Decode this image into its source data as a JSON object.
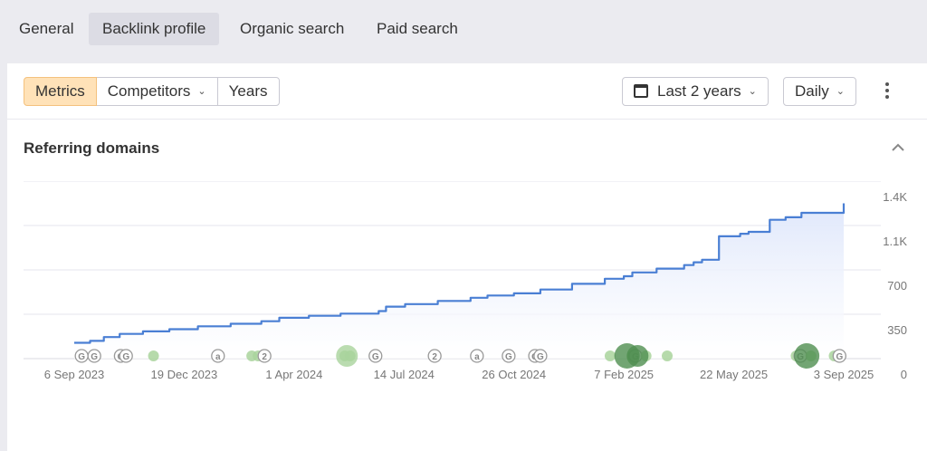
{
  "tabs": [
    "General",
    "Backlink profile",
    "Organic search",
    "Paid search"
  ],
  "active_tab": "Backlink profile",
  "toolbar": {
    "modes": [
      "Metrics",
      "Competitors",
      "Years"
    ],
    "active_mode": "Metrics",
    "date_range": "Last 2 years",
    "granularity": "Daily"
  },
  "card": {
    "title": "Referring domains"
  },
  "colors": {
    "line": "#4a7fd4",
    "area": "#dfe7fb",
    "event_light": "#a9d39c",
    "event_dark": "#4f8f50",
    "active_bg": "#ffe2b8"
  },
  "chart_data": {
    "type": "area",
    "title": "Referring domains",
    "x_tick_labels": [
      "6 Sep 2023",
      "19 Dec 2023",
      "1 Apr 2024",
      "14 Jul 2024",
      "26 Oct 2024",
      "7 Feb 2025",
      "22 May 2025",
      "3 Sep 2025"
    ],
    "y_tick_labels": [
      "1.4K",
      "1.1K",
      "700",
      "350",
      "0"
    ],
    "ylim": [
      0,
      1400
    ],
    "x_range": [
      "2023-09-06",
      "2025-09-03"
    ],
    "grid": true,
    "series": [
      {
        "x": [
          "2023-09-06",
          "2023-09-21",
          "2023-10-04",
          "2023-10-19",
          "2023-11-10",
          "2023-12-05",
          "2024-01-01",
          "2024-02-01",
          "2024-03-01",
          "2024-03-18",
          "2024-04-15",
          "2024-05-15",
          "2024-06-20",
          "2024-06-27",
          "2024-07-15",
          "2024-08-15",
          "2024-09-15",
          "2024-10-01",
          "2024-10-26",
          "2024-11-20",
          "2024-12-20",
          "2025-01-20",
          "2025-02-07",
          "2025-02-15",
          "2025-03-10",
          "2025-04-05",
          "2025-04-14",
          "2025-04-22",
          "2025-05-08",
          "2025-05-28",
          "2025-06-05",
          "2025-06-25",
          "2025-07-10",
          "2025-07-25",
          "2025-09-03"
        ],
        "y": [
          125,
          140,
          170,
          195,
          215,
          232,
          255,
          275,
          295,
          322,
          338,
          355,
          375,
          410,
          430,
          455,
          480,
          498,
          515,
          545,
          590,
          630,
          650,
          680,
          710,
          738,
          760,
          780,
          965,
          985,
          1000,
          1095,
          1115,
          1150,
          1225
        ]
      }
    ],
    "event_markers": [
      {
        "date": "2023-09-13",
        "label": "G"
      },
      {
        "date": "2023-09-25",
        "label": "G"
      },
      {
        "date": "2023-10-20",
        "label": "G"
      },
      {
        "date": "2023-10-25",
        "label": "G"
      },
      {
        "date": "2023-11-20",
        "label": ""
      },
      {
        "date": "2024-01-20",
        "label": "a"
      },
      {
        "date": "2024-02-21",
        "label": ""
      },
      {
        "date": "2024-02-27",
        "label": ""
      },
      {
        "date": "2024-03-04",
        "label": "2"
      },
      {
        "date": "2024-05-19",
        "label": ""
      },
      {
        "date": "2024-05-24",
        "label": ""
      },
      {
        "date": "2024-06-17",
        "label": "G"
      },
      {
        "date": "2024-08-12",
        "label": "2"
      },
      {
        "date": "2024-09-21",
        "label": "a"
      },
      {
        "date": "2024-10-21",
        "label": "G"
      },
      {
        "date": "2024-11-15",
        "label": "G"
      },
      {
        "date": "2024-11-20",
        "label": "G"
      },
      {
        "date": "2025-01-25",
        "label": ""
      },
      {
        "date": "2025-02-15",
        "label": ""
      },
      {
        "date": "2025-02-18",
        "label": "G"
      },
      {
        "date": "2025-02-28",
        "label": ""
      },
      {
        "date": "2025-03-20",
        "label": ""
      },
      {
        "date": "2025-07-20",
        "label": ""
      },
      {
        "date": "2025-07-24",
        "label": "G"
      },
      {
        "date": "2025-08-03",
        "label": ""
      },
      {
        "date": "2025-08-25",
        "label": ""
      },
      {
        "date": "2025-08-30",
        "label": "G"
      }
    ]
  }
}
